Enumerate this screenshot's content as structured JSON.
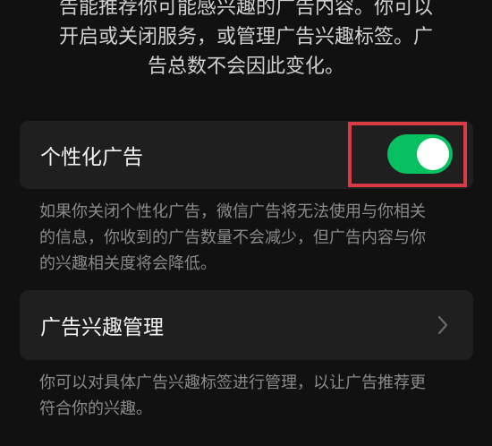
{
  "intro": {
    "line1": "告能推荐你可能感兴趣的广告内容。你可以",
    "line2": "开启或关闭服务，或管理广告兴趣标签。广",
    "line3": "告总数不会因此变化。"
  },
  "personalized_ads": {
    "label": "个性化广告",
    "enabled": true,
    "note_line1": "如果你关闭个性化广告，微信广告将无法使用与你相关",
    "note_line2": "的信息，你收到的广告数量不会减少，但广告内容与你",
    "note_line3": "的兴趣相关度将会降低。"
  },
  "interest_management": {
    "label": "广告兴趣管理",
    "note_line1": "你可以对具体广告兴趣标签进行管理，以让广告推荐更",
    "note_line2": "符合你的兴趣。"
  },
  "colors": {
    "background": "#111111",
    "card": "#1f1f1f",
    "toggle_on": "#07c160",
    "highlight_box": "#d93a44"
  },
  "icons": {
    "chevron": "chevron-right-icon"
  }
}
